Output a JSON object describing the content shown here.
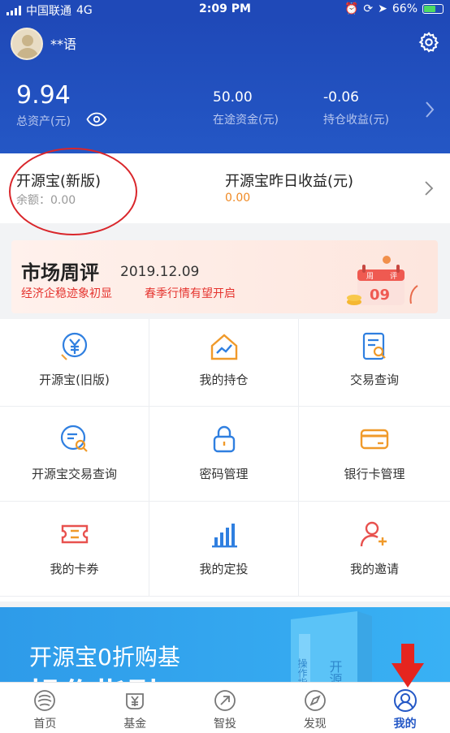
{
  "status_bar": {
    "carrier": "中国联通",
    "network": "4G",
    "time": "2:09 PM",
    "battery": "66%"
  },
  "header": {
    "username": "**语",
    "total_assets_value": "9.94",
    "total_assets_label": "总资产(元)",
    "in_transit_value": "50.00",
    "in_transit_label": "在途资金(元)",
    "holding_income_value": "-0.06",
    "holding_income_label": "持仓收益(元)"
  },
  "kaiyuanbao": {
    "title": "开源宝(新版)",
    "balance": "余额：0.00",
    "yesterday_title": "开源宝昨日收益(元)",
    "yesterday_value": "0.00"
  },
  "banner": {
    "title": "市场周评",
    "date": "2019.12.09",
    "subtitle_1": "经济企稳迹象初显",
    "subtitle_2": "春季行情有望开启",
    "calendar_left": "周",
    "calendar_right": "评",
    "calendar_day": "09"
  },
  "grid": {
    "items": [
      {
        "label": "开源宝(旧版)",
        "icon": "yen-shield-icon"
      },
      {
        "label": "我的持仓",
        "icon": "house-chart-icon"
      },
      {
        "label": "交易查询",
        "icon": "doc-search-icon"
      },
      {
        "label": "开源宝交易查询",
        "icon": "circle-search-icon"
      },
      {
        "label": "密码管理",
        "icon": "lock-icon"
      },
      {
        "label": "银行卡管理",
        "icon": "card-icon"
      },
      {
        "label": "我的卡券",
        "icon": "ticket-icon"
      },
      {
        "label": "我的定投",
        "icon": "bar-chart-icon"
      },
      {
        "label": "我的邀请",
        "icon": "person-plus-icon"
      }
    ]
  },
  "promo": {
    "line1": "开源宝0折购基",
    "line2": "操作指引",
    "book_text_1": "操作指",
    "book_text_2": "开源"
  },
  "tabbar": {
    "tabs": [
      {
        "label": "首页",
        "icon": "home-logo-icon"
      },
      {
        "label": "基金",
        "icon": "fund-icon"
      },
      {
        "label": "智投",
        "icon": "smart-invest-icon"
      },
      {
        "label": "发现",
        "icon": "compass-icon"
      },
      {
        "label": "我的",
        "icon": "user-icon"
      }
    ],
    "active_index": 4
  },
  "colors": {
    "header_blue": "#1f49b8",
    "accent_orange": "#f08a24",
    "annotation_red": "#d9262b",
    "active_tab": "#2458c6"
  }
}
